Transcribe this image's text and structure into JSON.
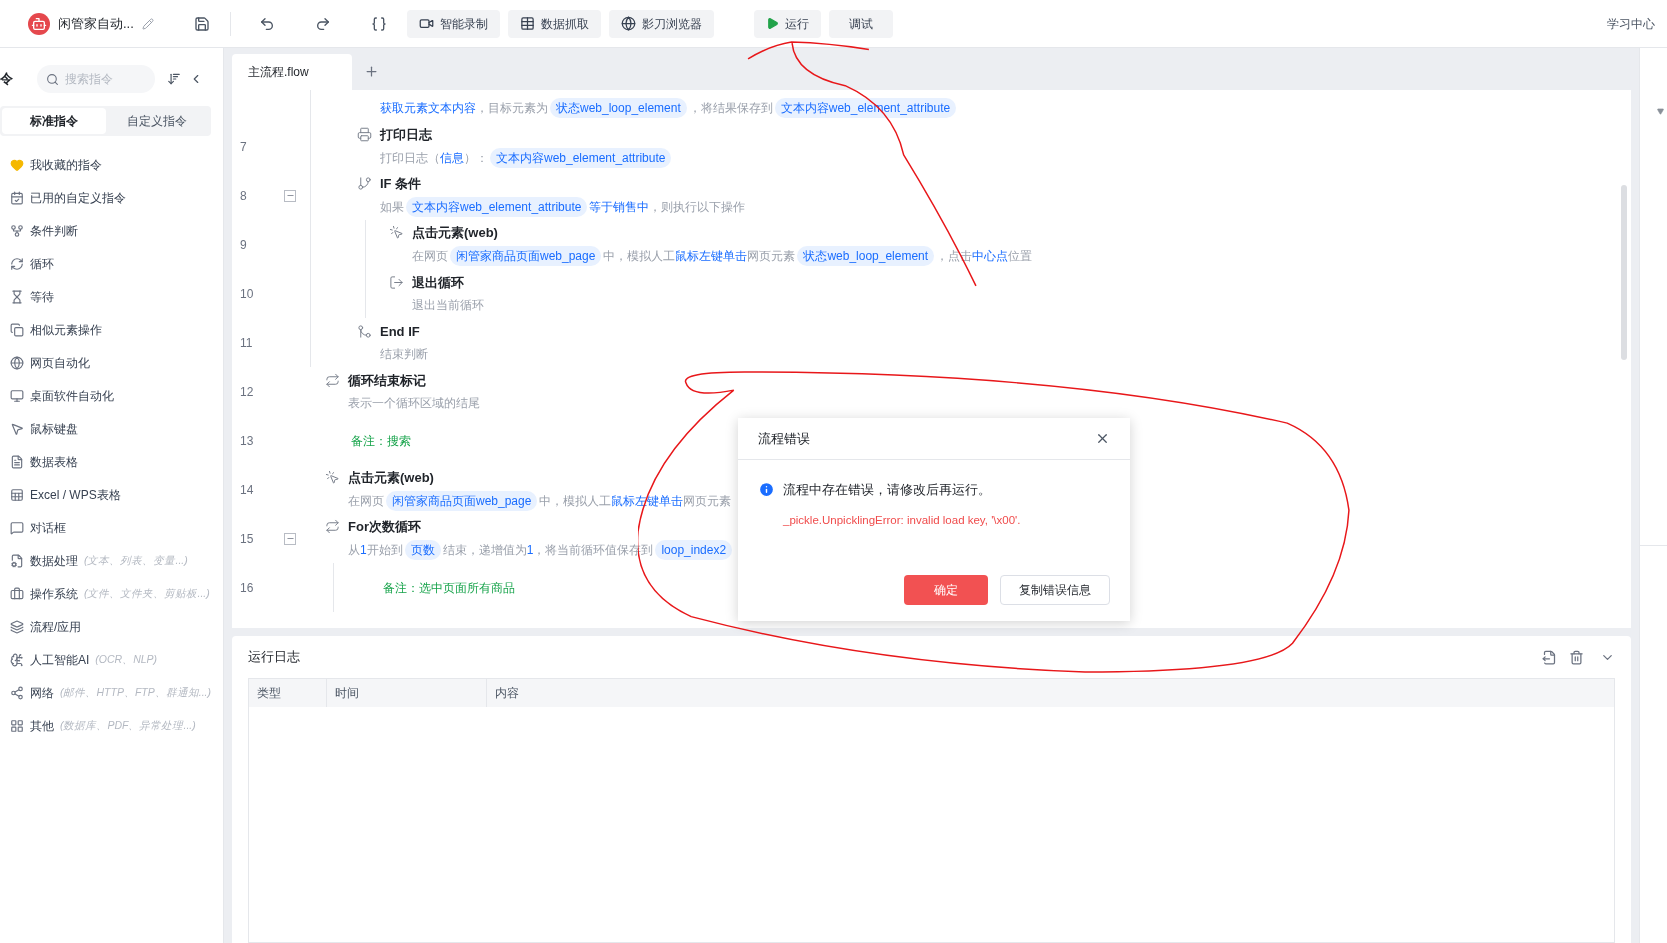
{
  "toolbar": {
    "app_title": "闲管家自动...",
    "buttons": [
      {
        "kind": "record",
        "label": "智能录制"
      },
      {
        "kind": "scrape",
        "label": "数据抓取"
      },
      {
        "kind": "browser",
        "label": "影刀浏览器"
      }
    ],
    "run": {
      "label": "运行"
    },
    "debug": {
      "label": "调试"
    },
    "help": "学习中心"
  },
  "sidebar": {
    "title": "令",
    "search": {
      "placeholder": "搜索指令"
    },
    "tabs": [
      {
        "label": "标准指令",
        "selected": true
      },
      {
        "label": "自定义指令",
        "selected": false
      }
    ],
    "items": [
      {
        "kind": "favorites",
        "label": "我收藏的指令"
      },
      {
        "kind": "custom",
        "label": "已用的自定义指令"
      },
      {
        "kind": "condition",
        "label": "条件判断"
      },
      {
        "kind": "loop",
        "label": "循环"
      },
      {
        "kind": "wait",
        "label": "等待"
      },
      {
        "kind": "similar",
        "label": "相似元素操作"
      },
      {
        "kind": "web",
        "label": "网页自动化"
      },
      {
        "kind": "desktop",
        "label": "桌面软件自动化"
      },
      {
        "kind": "mouse",
        "label": "鼠标键盘"
      },
      {
        "kind": "datatable",
        "label": "数据表格"
      },
      {
        "kind": "excel",
        "label": "Excel / WPS表格"
      },
      {
        "kind": "dialog",
        "label": "对话框"
      },
      {
        "kind": "data",
        "label": "数据处理",
        "hint": "(文本、列表、变量...)"
      },
      {
        "kind": "system",
        "label": "操作系统",
        "hint": "(文件、文件夹、剪贴板...)"
      },
      {
        "kind": "process",
        "label": "流程/应用"
      },
      {
        "kind": "ai",
        "label": "人工智能AI",
        "hint": "(OCR、NLP)"
      },
      {
        "kind": "network",
        "label": "网络",
        "hint": "(邮件、HTTP、FTP、群通知...)"
      },
      {
        "kind": "other",
        "label": "其他",
        "hint": "(数据库、PDF、异常处理...)"
      }
    ]
  },
  "editor": {
    "tabs": [
      {
        "label": "主流程.flow",
        "selected": true
      }
    ],
    "steps": [
      {
        "kind": "continuation",
        "children": [
          {
            "kind": "extract",
            "desc": [
              {
                "kind": "keyword",
                "text": "获取元素文本内容"
              },
              {
                "kind": "text",
                "text": "，目标元素为"
              },
              {
                "kind": "variable",
                "text": "状态web_loop_element"
              },
              {
                "kind": "text",
                "text": "，将结果保存到"
              },
              {
                "kind": "variable",
                "text": "文本内容web_element_attribute"
              }
            ]
          },
          {
            "line": "7",
            "kind": "print",
            "title": "打印日志",
            "desc": [
              {
                "kind": "text",
                "text": "打印日志（"
              },
              {
                "kind": "keyword",
                "text": "信息"
              },
              {
                "kind": "text",
                "text": "）："
              },
              {
                "kind": "variable",
                "text": "文本内容web_element_attribute"
              }
            ]
          },
          {
            "line": "8",
            "kind": "if",
            "title": "IF 条件",
            "expanded": true,
            "desc": [
              {
                "kind": "text",
                "text": "如果"
              },
              {
                "kind": "variable",
                "text": "文本内容web_element_attribute"
              },
              {
                "kind": "keyword",
                "text": "等于销售中"
              },
              {
                "kind": "text",
                "text": "，则执行以下操作"
              }
            ],
            "children": [
              {
                "line": "9",
                "kind": "click",
                "title": "点击元素(web)",
                "desc": [
                  {
                    "kind": "text",
                    "text": "在网页"
                  },
                  {
                    "kind": "variable",
                    "text": "闲管家商品页面web_page"
                  },
                  {
                    "kind": "text",
                    "text": "中，模拟人工"
                  },
                  {
                    "kind": "keyword",
                    "text": "鼠标左键单击"
                  },
                  {
                    "kind": "text",
                    "text": "网页元素"
                  },
                  {
                    "kind": "variable",
                    "text": "状态web_loop_element"
                  },
                  {
                    "kind": "text",
                    "text": "，点击"
                  },
                  {
                    "kind": "keyword",
                    "text": "中心点"
                  },
                  {
                    "kind": "text",
                    "text": "位置"
                  }
                ]
              },
              {
                "line": "10",
                "kind": "break",
                "title": "退出循环",
                "desc": [
                  {
                    "kind": "text",
                    "text": "退出当前循环"
                  }
                ]
              }
            ]
          },
          {
            "line": "11",
            "kind": "endif",
            "title": "End IF",
            "desc": [
              {
                "kind": "text",
                "text": "结束判断"
              }
            ]
          }
        ]
      },
      {
        "line": "12",
        "kind": "loopend",
        "title": "循环结束标记",
        "desc": [
          {
            "kind": "text",
            "text": "表示一个循环区域的结尾"
          }
        ]
      },
      {
        "line": "13",
        "kind": "comment",
        "text": "备注：搜索"
      },
      {
        "line": "14",
        "kind": "click",
        "title": "点击元素(web)",
        "desc": [
          {
            "kind": "text",
            "text": "在网页"
          },
          {
            "kind": "variable",
            "text": "闲管家商品页面web_page"
          },
          {
            "kind": "text",
            "text": "中，模拟人工"
          },
          {
            "kind": "keyword",
            "text": "鼠标左键单击"
          },
          {
            "kind": "text",
            "text": "网页元素"
          }
        ]
      },
      {
        "line": "15",
        "kind": "for",
        "title": "For次数循环",
        "expanded": true,
        "desc": [
          {
            "kind": "text",
            "text": "从"
          },
          {
            "kind": "keyword",
            "text": "1"
          },
          {
            "kind": "text",
            "text": "开始到"
          },
          {
            "kind": "variable",
            "text": "页数"
          },
          {
            "kind": "text",
            "text": "结束，递增值为"
          },
          {
            "kind": "keyword",
            "text": "1"
          },
          {
            "kind": "text",
            "text": "，将当前循环值保存到"
          },
          {
            "kind": "variable",
            "text": "loop_index2"
          }
        ],
        "children": [
          {
            "line": "16",
            "kind": "comment",
            "text": "备注：选中页面所有商品"
          }
        ]
      }
    ]
  },
  "log": {
    "title": "运行日志",
    "columns": [
      "类型",
      "时间",
      "内容"
    ]
  },
  "dialog": {
    "title": "流程错误",
    "message": "流程中存在错误，请修改后再运行。",
    "error": "_pickle.UnpicklingError: invalid load key, '\\x00'.",
    "buttons": [
      {
        "kind": "primary",
        "label": "确定"
      },
      {
        "kind": "secondary",
        "label": "复制错误信息"
      }
    ]
  }
}
